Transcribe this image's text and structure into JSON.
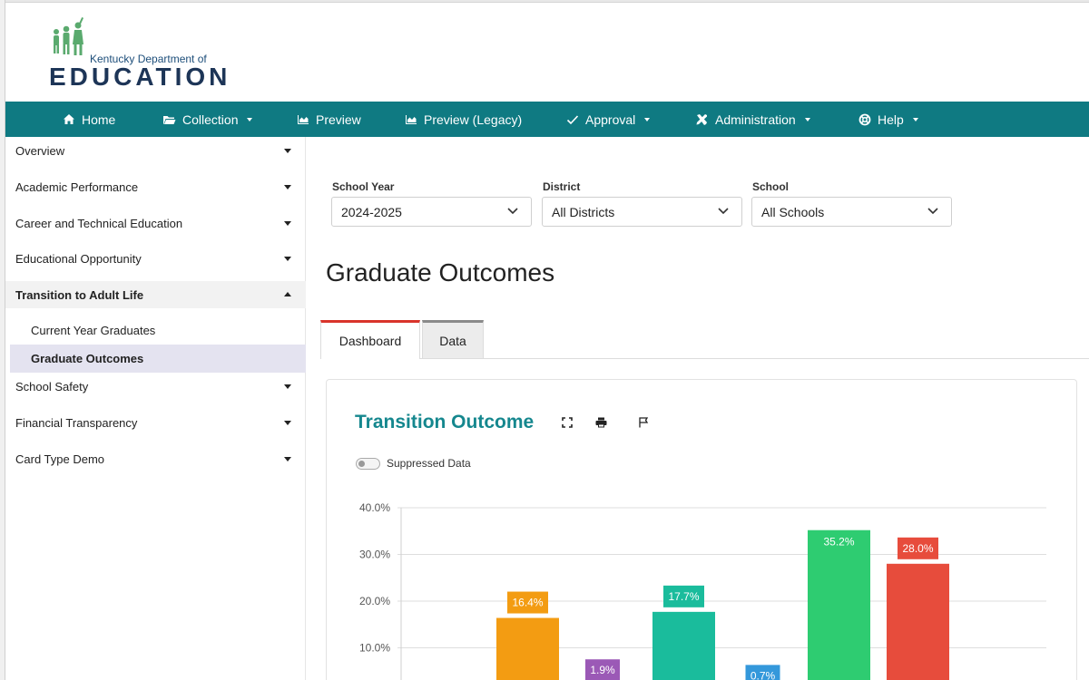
{
  "header": {
    "logo_small": "Kentucky Department of",
    "logo_big": "EDUCATION",
    "logo_color": "#1d3557",
    "figures_color": "#5aaa6e"
  },
  "nav": {
    "bg_color": "#0f7a82",
    "items": [
      {
        "label": "Home",
        "icon": "home-icon",
        "dropdown": false
      },
      {
        "label": "Collection",
        "icon": "folder-icon",
        "dropdown": true
      },
      {
        "label": "Preview",
        "icon": "area-chart-icon",
        "dropdown": false
      },
      {
        "label": "Preview (Legacy)",
        "icon": "area-chart-icon",
        "dropdown": false
      },
      {
        "label": "Approval",
        "icon": "check-icon",
        "dropdown": true
      },
      {
        "label": "Administration",
        "icon": "tools-icon",
        "dropdown": true
      },
      {
        "label": "Help",
        "icon": "lifebuoy-icon",
        "dropdown": true
      }
    ]
  },
  "sidebar": {
    "items": [
      {
        "label": "Overview",
        "expanded": false
      },
      {
        "label": "Academic Performance",
        "expanded": false
      },
      {
        "label": "Career and Technical Education",
        "expanded": false
      },
      {
        "label": "Educational Opportunity",
        "expanded": false
      },
      {
        "label": "Transition to Adult Life",
        "expanded": true
      },
      {
        "label": "School Safety",
        "expanded": false
      },
      {
        "label": "Financial Transparency",
        "expanded": false
      },
      {
        "label": "Card Type Demo",
        "expanded": false
      }
    ],
    "subitems": [
      {
        "label": "Current Year Graduates",
        "selected": false
      },
      {
        "label": "Graduate Outcomes",
        "selected": true
      }
    ]
  },
  "filters": {
    "school_year": {
      "label": "School Year",
      "value": "2024-2025"
    },
    "district": {
      "label": "District",
      "value": "All Districts"
    },
    "school": {
      "label": "School",
      "value": "All Schools"
    }
  },
  "page": {
    "title": "Graduate Outcomes"
  },
  "tabs": [
    {
      "label": "Dashboard",
      "active": true
    },
    {
      "label": "Data",
      "active": false
    }
  ],
  "card": {
    "title": "Transition Outcome",
    "title_color": "#15878e",
    "icons": [
      "fullscreen-icon",
      "print-icon",
      "flag-icon"
    ],
    "toggle_label": "Suppressed Data",
    "toggle_on": false
  },
  "chart_data": {
    "type": "bar",
    "title": "Transition Outcome",
    "y_ticks": [
      "10.0%",
      "20.0%",
      "30.0%",
      "40.0%"
    ],
    "ylim": [
      0,
      40
    ],
    "grid": true,
    "values": [
      16.4,
      1.9,
      17.7,
      0.7,
      35.2,
      28.0
    ],
    "labels": [
      "16.4%",
      "1.9%",
      "17.7%",
      "0.7%",
      "35.2%",
      "28.0%"
    ],
    "colors": [
      "#f39c12",
      "#9b59b6",
      "#1abc9c",
      "#3498db",
      "#2ecc71",
      "#e74c3c"
    ]
  }
}
